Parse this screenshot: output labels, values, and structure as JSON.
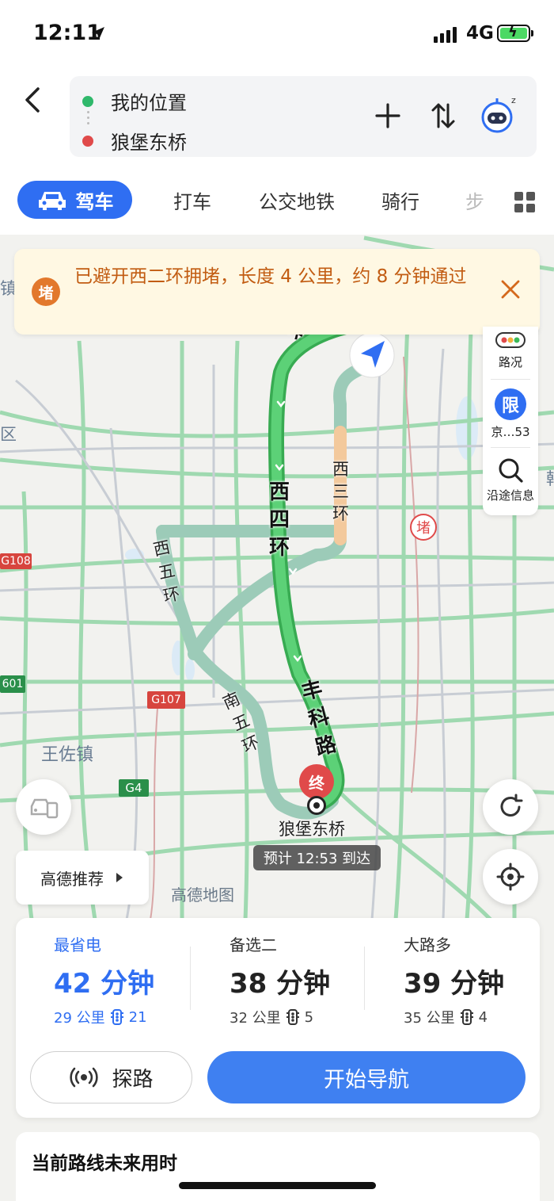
{
  "status": {
    "time": "12:11",
    "network": "4G"
  },
  "header": {
    "origin": "我的位置",
    "destination": "狼堡东桥"
  },
  "tabs": [
    {
      "label": "驾车"
    },
    {
      "label": "打车"
    },
    {
      "label": "公交地铁"
    },
    {
      "label": "骑行"
    },
    {
      "label": "步"
    }
  ],
  "banner": {
    "badge": "堵",
    "message": "已避开西二环拥堵，长度 4 公里，约 8 分钟通过"
  },
  "side_panel": {
    "traffic": "路况",
    "limit_badge": "限",
    "limit_text": "京…53",
    "along_route": "沿途信息"
  },
  "map": {
    "road_labels": {
      "north4": "北四环",
      "west4": "西四环",
      "west3": "西三环",
      "west5": "西五环",
      "south5": "南五环",
      "fengke": "丰科路"
    },
    "highway_tags": {
      "g108": "G108",
      "g107": "G107",
      "g4": "G4",
      "g601": "601"
    },
    "place_labels": {
      "wangzuo": "王佐镇",
      "qu": "区",
      "zhen": "镇",
      "han": "韩"
    },
    "jam_marker": "堵",
    "dest_marker": "终",
    "dest_name": "狼堡东桥",
    "eta": "预计 12:53 到达",
    "watermark": "高德地图",
    "recommend": "高德推荐"
  },
  "routes": [
    {
      "tag": "最省电",
      "duration": "42 分钟",
      "distance": "29 公里",
      "lights": "21",
      "selected": true
    },
    {
      "tag": "备选二",
      "duration": "38 分钟",
      "distance": "32 公里",
      "lights": "5",
      "selected": false
    },
    {
      "tag": "大路多",
      "duration": "39 分钟",
      "distance": "35 公里",
      "lights": "4",
      "selected": false
    }
  ],
  "actions": {
    "probe": "探路",
    "navigate": "开始导航"
  },
  "future": {
    "title": "当前路线未来用时"
  },
  "colors": {
    "accent": "#2f6ef2",
    "route": "#3dba5a",
    "jam": "#e2782c",
    "destination": "#e04a4a"
  }
}
